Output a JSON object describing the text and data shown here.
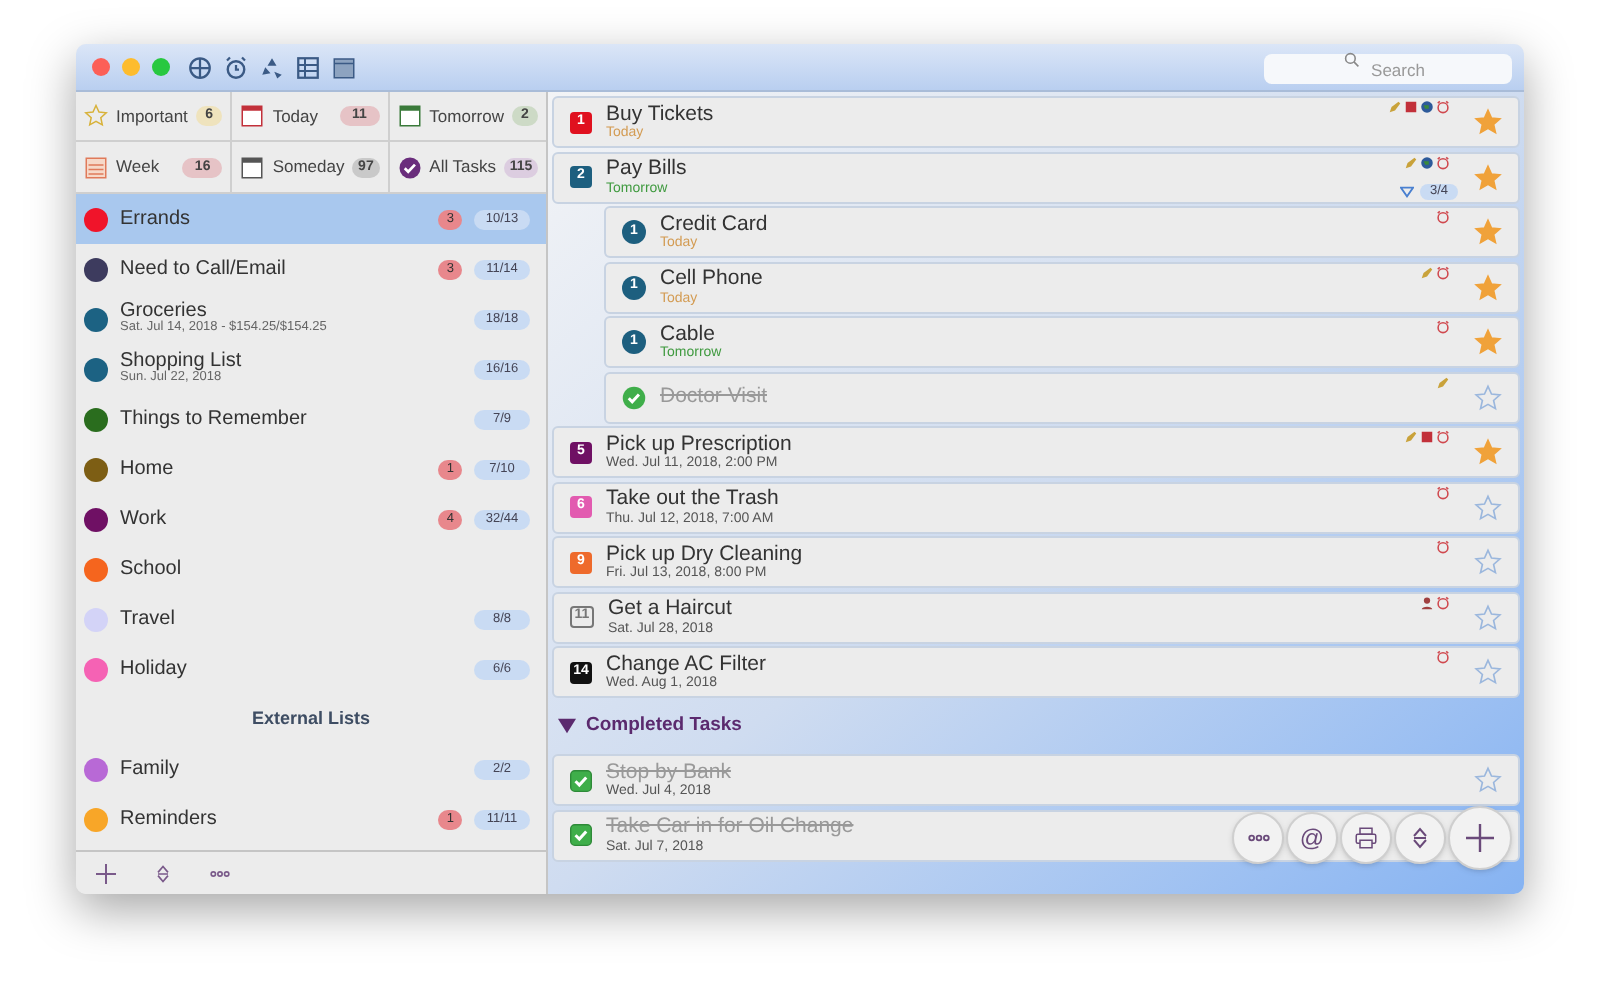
{
  "toolbar": {
    "search": {
      "placeholder": "Search"
    }
  },
  "smart_lists": [
    {
      "label": "Important",
      "count": "6",
      "kind": "star",
      "color": "#efe3bd",
      "selected": false
    },
    {
      "label": "Today",
      "count": "11",
      "kind": "calendar",
      "color": "#e6c3c6",
      "selected": false
    },
    {
      "label": "Tomorrow",
      "count": "2",
      "kind": "calendar-next",
      "color": "#cddac6",
      "selected": false
    },
    {
      "label": "Week",
      "count": "16",
      "kind": "week",
      "color": "#e6c3c6",
      "selected": false
    },
    {
      "label": "Someday",
      "count": "97",
      "kind": "someday",
      "color": "#c9c9c9",
      "selected": false
    },
    {
      "label": "All Tasks",
      "count": "115",
      "kind": "check",
      "color": "#dccde0",
      "selected": false
    }
  ],
  "lists": [
    {
      "name": "Errands",
      "color": "#f0142a",
      "overdue": "3",
      "progress": "10/13",
      "selected": true
    },
    {
      "name": "Need to Call/Email",
      "color": "#3d3b5e",
      "overdue": "3",
      "progress": "11/14",
      "selected": false
    },
    {
      "name": "Groceries",
      "subtitle": "Sat. Jul 14, 2018 - $154.25/$154.25",
      "color": "#1c6283",
      "progress": "18/18",
      "selected": false
    },
    {
      "name": "Shopping List",
      "subtitle": "Sun. Jul 22, 2018",
      "color": "#1c6283",
      "progress": "16/16",
      "selected": false
    },
    {
      "name": "Things to Remember",
      "color": "#2a6d1e",
      "progress": "7/9",
      "selected": false
    },
    {
      "name": "Home",
      "color": "#7d5e14",
      "overdue": "1",
      "progress": "7/10",
      "selected": false
    },
    {
      "name": "Work",
      "color": "#6f1064",
      "overdue": "4",
      "progress": "32/44",
      "selected": false
    },
    {
      "name": "School",
      "color": "#f5651e",
      "selected": false
    },
    {
      "name": "Travel",
      "color": "#d3d3f7",
      "progress": "8/8",
      "selected": false
    },
    {
      "name": "Holiday",
      "color": "#f562b4",
      "progress": "6/6",
      "selected": false
    }
  ],
  "external_header": "External Lists",
  "external_lists": [
    {
      "name": "Family",
      "color": "#b869d6",
      "progress": "2/2",
      "selected": false
    },
    {
      "name": "Reminders",
      "color": "#f8a628",
      "overdue": "1",
      "progress": "11/11",
      "selected": false
    }
  ],
  "tasks": [
    {
      "name": "Buy Tickets",
      "due": {
        "text": "Today",
        "kind": "today"
      },
      "kind": "square",
      "badge": "1",
      "color": "#e0111f",
      "starred": true,
      "completed": false,
      "indicators": [
        {
          "kind": "note"
        },
        {
          "kind": "calendar"
        },
        {
          "kind": "globe"
        },
        {
          "kind": "alarm"
        }
      ]
    },
    {
      "name": "Pay Bills",
      "due": {
        "text": "Tomorrow",
        "kind": "tomorrow"
      },
      "kind": "square",
      "badge": "2",
      "color": "#1d5f7f",
      "starred": true,
      "completed": false,
      "indicators": [
        {
          "kind": "note"
        },
        {
          "kind": "globe"
        },
        {
          "kind": "alarm"
        }
      ],
      "subtask_progress": "3/4",
      "expanded": true,
      "children": [
        {
          "name": "Credit Card",
          "due": {
            "text": "Today",
            "kind": "today"
          },
          "kind": "circle",
          "badge": "1",
          "color": "#1d5f7f",
          "starred": true,
          "completed": false,
          "indicators": [
            {
              "kind": "alarm"
            }
          ]
        },
        {
          "name": "Cell Phone",
          "due": {
            "text": "Today",
            "kind": "today"
          },
          "kind": "circle",
          "badge": "1",
          "color": "#1d5f7f",
          "starred": true,
          "completed": false,
          "indicators": [
            {
              "kind": "note"
            },
            {
              "kind": "alarm"
            }
          ]
        },
        {
          "name": "Cable",
          "due": {
            "text": "Tomorrow",
            "kind": "tomorrow"
          },
          "kind": "circle",
          "badge": "1",
          "color": "#1d5f7f",
          "starred": true,
          "completed": false,
          "indicators": [
            {
              "kind": "alarm"
            }
          ]
        },
        {
          "name": "Doctor Visit",
          "kind": "check",
          "starred": false,
          "completed": true,
          "indicators": [
            {
              "kind": "note"
            }
          ]
        }
      ]
    },
    {
      "name": "Pick up Prescription",
      "due": {
        "text": "Wed. Jul 11, 2018, 2:00 PM",
        "kind": "date"
      },
      "kind": "square",
      "badge": "5",
      "color": "#6f1064",
      "starred": true,
      "completed": false,
      "indicators": [
        {
          "kind": "note"
        },
        {
          "kind": "calendar"
        },
        {
          "kind": "alarm"
        }
      ]
    },
    {
      "name": "Take out the Trash",
      "due": {
        "text": "Thu. Jul 12, 2018, 7:00 AM",
        "kind": "date"
      },
      "kind": "square",
      "badge": "6",
      "color": "#e25bb0",
      "starred": false,
      "completed": false,
      "indicators": [
        {
          "kind": "alarm"
        }
      ]
    },
    {
      "name": "Pick up Dry Cleaning",
      "due": {
        "text": "Fri. Jul 13, 2018, 8:00 PM",
        "kind": "date"
      },
      "kind": "square",
      "badge": "9",
      "color": "#ee6a2b",
      "starred": false,
      "completed": false,
      "indicators": [
        {
          "kind": "alarm"
        }
      ]
    },
    {
      "name": "Get a Haircut",
      "due": {
        "text": "Sat. Jul 28, 2018",
        "kind": "date"
      },
      "kind": "outline",
      "badge": "11",
      "color": "#777777",
      "starred": false,
      "completed": false,
      "indicators": [
        {
          "kind": "person"
        },
        {
          "kind": "alarm"
        }
      ]
    },
    {
      "name": "Change AC Filter",
      "due": {
        "text": "Wed. Aug 1, 2018",
        "kind": "date"
      },
      "kind": "square",
      "badge": "14",
      "color": "#111111",
      "starred": false,
      "completed": false,
      "indicators": [
        {
          "kind": "alarm"
        }
      ]
    }
  ],
  "completed_section": {
    "title": "Completed Tasks",
    "expanded": true,
    "tasks": [
      {
        "name": "Stop by Bank",
        "due": {
          "text": "Wed. Jul 4, 2018",
          "kind": "date"
        },
        "kind": "checkbox",
        "starred": false,
        "completed": true
      },
      {
        "name": "Take Car in for Oil Change",
        "due": {
          "text": "Sat. Jul 7, 2018",
          "kind": "date"
        },
        "kind": "checkbox",
        "completed": true
      }
    ]
  },
  "floating_buttons": [
    {
      "kind": "more"
    },
    {
      "kind": "at",
      "label": "@"
    },
    {
      "kind": "print"
    },
    {
      "kind": "sort"
    },
    {
      "kind": "add"
    }
  ]
}
